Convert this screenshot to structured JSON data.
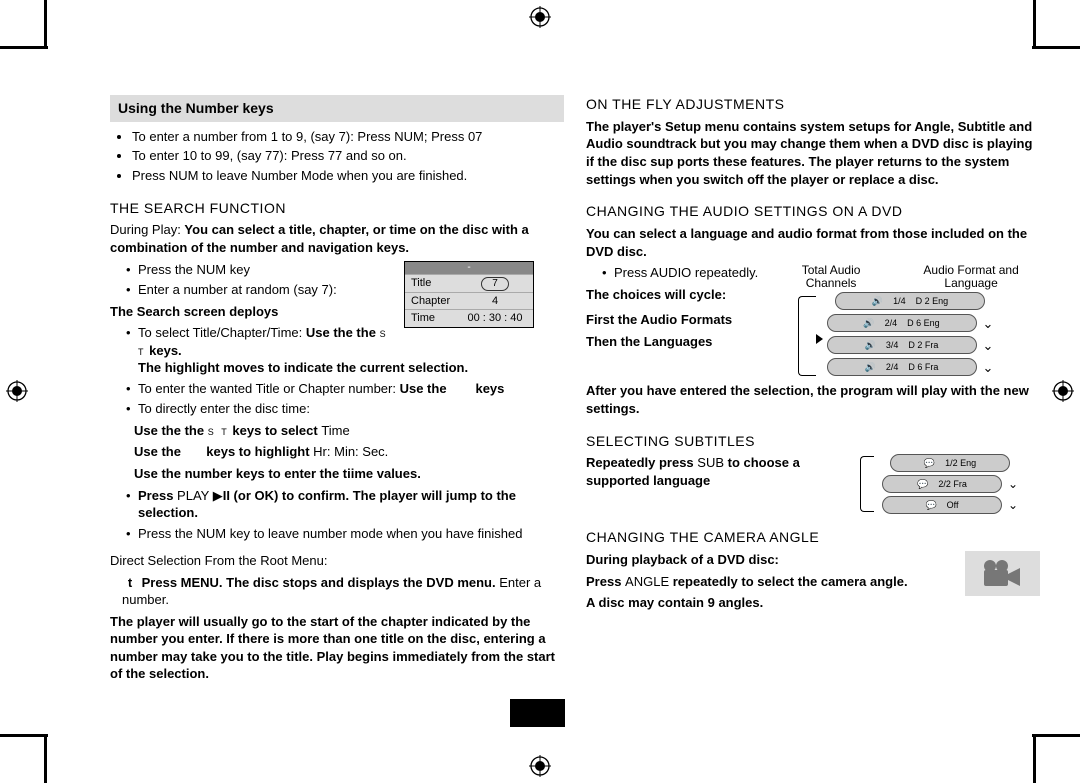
{
  "left": {
    "box_heading": "Using the Number keys",
    "box_items": [
      "To enter a number from 1 to 9, (say 7): Press NUM; Press 07",
      "To enter 10 to 99, (say 77): Press 77 and so on.",
      "Press NUM to leave Number Mode when you are finished."
    ],
    "search_heading": "THE SEARCH FUNCTION",
    "search_intro_a": "During Play: ",
    "search_intro_b": "You can select a title, chapter, or time on the disc with a combination of the number and navigation keys.",
    "search_steps": [
      "Press the NUM key",
      "Enter a number at random (say 7):"
    ],
    "deploys": "The Search screen deploys",
    "osd": {
      "title": "Title",
      "title_val": "7",
      "chapter": "Chapter",
      "chapter_val": "4",
      "time": "Time",
      "time_val": "00 : 30 : 40"
    },
    "select_title_a": "To select Title/Chapter/Time: ",
    "select_title_b": "Use the  the",
    "select_title_c": " keys.",
    "select_title_d": "The highlight moves to indicate the current selection.",
    "enter_wanted_a": "To enter the wanted Title or Chapter number: ",
    "enter_wanted_b": "Use the",
    "enter_wanted_c": "keys",
    "direct_time": "To directly enter the disc time:",
    "direct_time_l1a": "Use the  the ",
    "direct_time_l1b": " keys  to select ",
    "direct_time_l1c": "Time",
    "direct_time_l2a": "Use the",
    "direct_time_l2b": "keys  to highlight ",
    "direct_time_l2c": "Hr: Min: Sec.",
    "direct_time_l3": "Use the number keys to enter the tiime values.",
    "press_play_a": "Press ",
    "press_play_b": "PLAY ",
    "press_play_c": " (or OK) to confirm. The player will jump to the selection.",
    "press_num_leave": "Press the NUM key to leave number mode when you have finished",
    "direct_sel": "Direct Selection From the Root Menu:",
    "t_press_a": "Press MENU. The disc stops and displays the DVD menu.",
    "t_press_b": "  Enter a number.",
    "tail": "The player will usually go to the start of the chapter indicated by the number you enter. If there is more than one title on the disc, entering a number may take you to the title. Play begins immediately from the start of the selection."
  },
  "right": {
    "onfly_heading": "ON THE FLY ADJUSTMENTS",
    "onfly_body": "The player's Setup menu contains system setups for Angle, Subtitle and Audio soundtrack but you may change them when a DVD disc is playing if the disc sup ports these features. The player returns to the system settings when you switch off the player or replace a disc.",
    "audio_heading": "CHANGING THE AUDIO SETTINGS ON A DVD",
    "audio_intro": "You can select a language and audio format from those included on the DVD disc.",
    "audio_step": "Press AUDIO repeatedly.",
    "choices": "The choices will cycle:",
    "first_audio": "First the Audio Formats",
    "then_lang": "Then the Languages",
    "label_total": "Total Audio Channels",
    "label_format": "Audio Format and Language",
    "chips": [
      {
        "n": "1/4",
        "fmt": "D 2 Eng"
      },
      {
        "n": "2/4",
        "fmt": "D 6 Eng"
      },
      {
        "n": "3/4",
        "fmt": "D 2 Fra"
      },
      {
        "n": "2/4",
        "fmt": "D 6 Fra"
      }
    ],
    "after_enter": "After you have entered the selection, the program will play with the new settings.",
    "sub_heading": "SELECTING SUBTITLES",
    "sub_body_a": "Repeatedly press ",
    "sub_body_b": "SUB",
    "sub_body_c": " to choose a supported language",
    "sub_chips": [
      {
        "t": "1/2  Eng"
      },
      {
        "t": "2/2  Fra"
      },
      {
        "t": "Off"
      }
    ],
    "angle_heading": "CHANGING THE CAMERA ANGLE",
    "angle_body1": "During playback of a DVD disc:",
    "angle_body2a": "Press ",
    "angle_body2b": "ANGLE",
    "angle_body2c": " repeatedly to select the camera angle.",
    "angle_body3": "A disc may contain 9  angles."
  }
}
